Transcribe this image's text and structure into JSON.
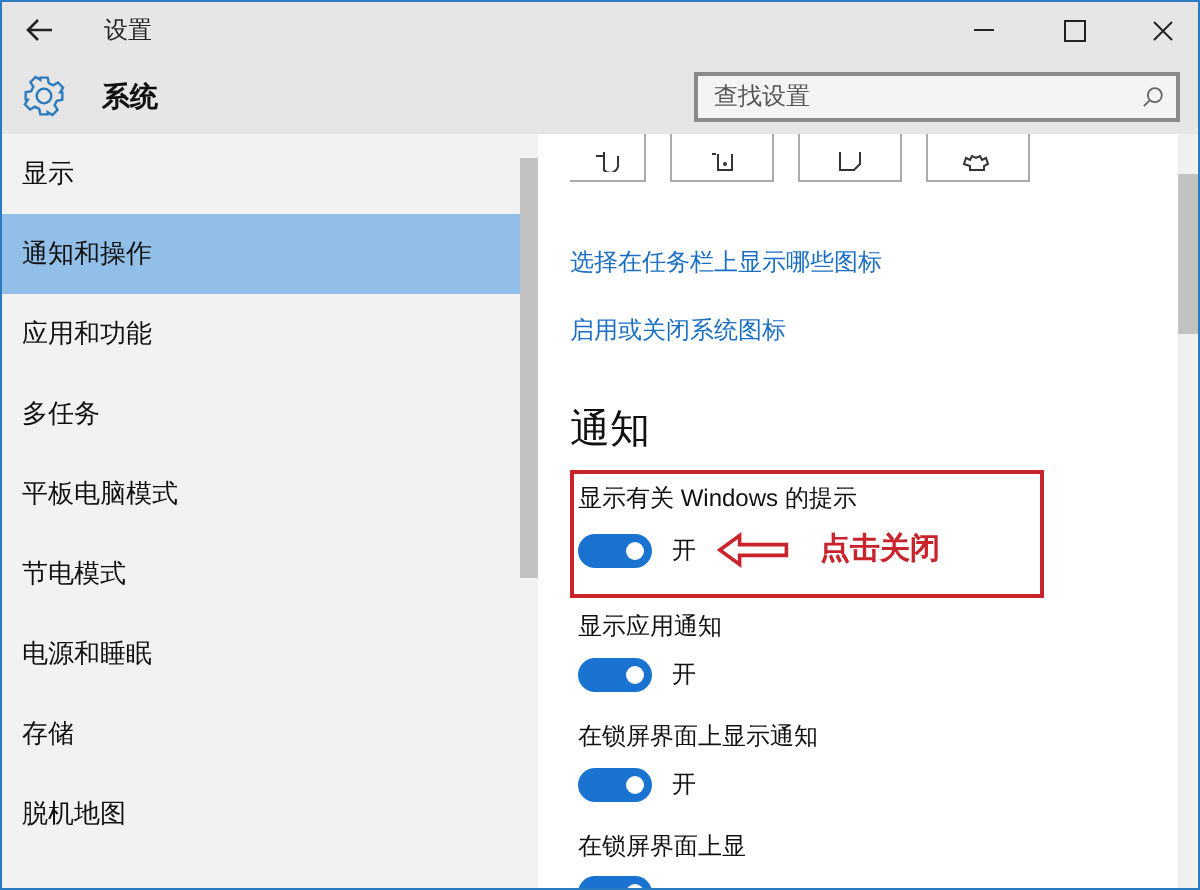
{
  "window": {
    "title": "设置"
  },
  "header": {
    "title": "系统",
    "search": {
      "placeholder": "查找设置"
    }
  },
  "sidebar": {
    "items": [
      {
        "label": "显示",
        "selected": false
      },
      {
        "label": "通知和操作",
        "selected": true
      },
      {
        "label": "应用和功能",
        "selected": false
      },
      {
        "label": "多任务",
        "selected": false
      },
      {
        "label": "平板电脑模式",
        "selected": false
      },
      {
        "label": "节电模式",
        "selected": false
      },
      {
        "label": "电源和睡眠",
        "selected": false
      },
      {
        "label": "存储",
        "selected": false
      },
      {
        "label": "脱机地图",
        "selected": false
      }
    ]
  },
  "content": {
    "links": [
      "选择在任务栏上显示哪些图标",
      "启用或关闭系统图标"
    ],
    "section_title": "通知",
    "toggles": [
      {
        "label": "显示有关 Windows 的提示",
        "on": true,
        "state_text": "开",
        "highlighted": true
      },
      {
        "label": "显示应用通知",
        "on": true,
        "state_text": "开",
        "highlighted": false
      },
      {
        "label": "在锁屏界面上显示通知",
        "on": true,
        "state_text": "开",
        "highlighted": false
      },
      {
        "label": "在锁屏界面上显",
        "on": true,
        "highlighted": false
      }
    ],
    "annotation": {
      "text": "点击关闭"
    }
  }
}
